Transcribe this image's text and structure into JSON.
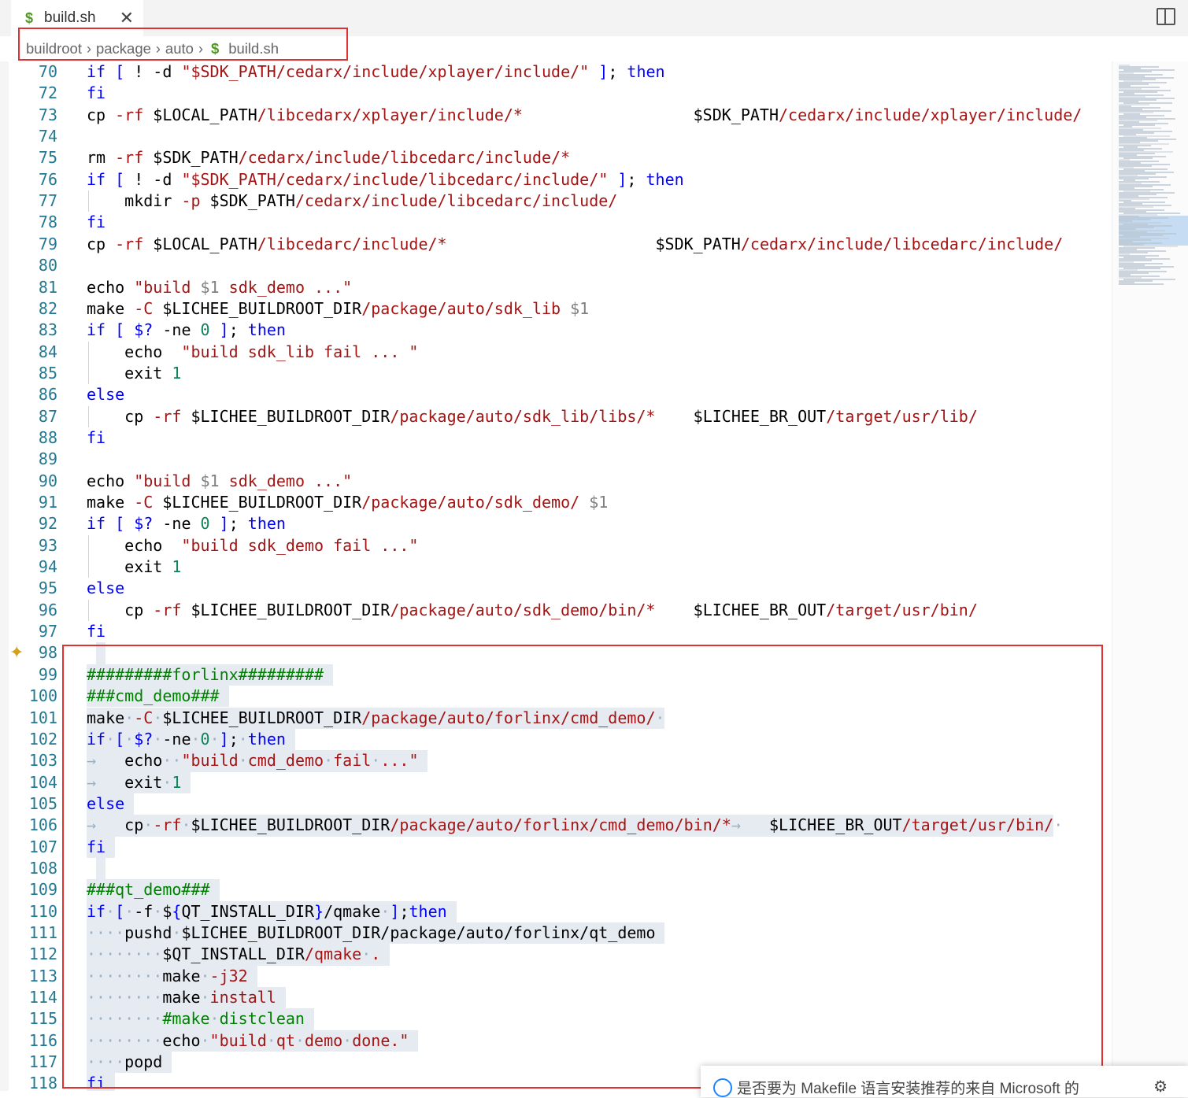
{
  "tab": {
    "icon": "$",
    "label": "build.sh",
    "close": "✕"
  },
  "breadcrumb": [
    {
      "label": "buildroot"
    },
    {
      "label": "package"
    },
    {
      "label": "auto"
    },
    {
      "label": "build.sh",
      "icon": "$"
    }
  ],
  "editor": {
    "lines": [
      {
        "n": "70",
        "indent": 0,
        "html": "<span class='kw'>if</span> <span class='kw'>[</span> ! -d <span class='str'>\"$SDK_PATH</span><span class='path'>/cedarx/include/xplayer/include/\"</span> <span class='kw'>]</span>; <span class='kw'>then</span>"
      },
      {
        "n": "72",
        "indent": 0,
        "html": "<span class='kw'>fi</span>"
      },
      {
        "n": "73",
        "indent": 0,
        "html": "cp <span class='str'>-rf</span> $LOCAL_PATH<span class='path'>/libcedarx/xplayer/include/*</span>                  $SDK_PATH<span class='path'>/cedarx/include/xplayer/include/</span>"
      },
      {
        "n": "74",
        "indent": 0,
        "html": ""
      },
      {
        "n": "75",
        "indent": 0,
        "html": "rm <span class='str'>-rf</span> $SDK_PATH<span class='path'>/cedarx/include/libcedarc/include/*</span>"
      },
      {
        "n": "76",
        "indent": 0,
        "html": "<span class='kw'>if</span> <span class='kw'>[</span> ! -d <span class='str'>\"$SDK_PATH</span><span class='path'>/cedarx/include/libcedarc/include/\"</span> <span class='kw'>]</span>; <span class='kw'>then</span>"
      },
      {
        "n": "77",
        "indent": 1,
        "html": "    mkdir <span class='str'>-p</span> $SDK_PATH<span class='path'>/cedarx/include/libcedarc/include/</span>"
      },
      {
        "n": "78",
        "indent": 0,
        "html": "<span class='kw'>fi</span>"
      },
      {
        "n": "79",
        "indent": 0,
        "html": "cp <span class='str'>-rf</span> $LOCAL_PATH<span class='path'>/libcedarc/include/*</span>                      $SDK_PATH<span class='path'>/cedarx/include/libcedarc/include/</span>"
      },
      {
        "n": "80",
        "indent": 0,
        "html": ""
      },
      {
        "n": "81",
        "indent": 0,
        "html": "echo <span class='str'>\"build </span><span class='arg'>$1</span><span class='str'> sdk_demo ...\"</span>"
      },
      {
        "n": "82",
        "indent": 0,
        "html": "make <span class='str'>-C</span> $LICHEE_BUILDROOT_DIR<span class='path'>/package/auto/sdk_lib</span> <span class='arg'>$1</span>"
      },
      {
        "n": "83",
        "indent": 0,
        "html": "<span class='kw'>if</span> <span class='kw'>[</span> <span class='kw'>$?</span> -ne <span class='num'>0</span> <span class='kw'>]</span>; <span class='kw'>then</span>"
      },
      {
        "n": "84",
        "indent": 1,
        "html": "    echo  <span class='str'>\"build sdk_lib fail ... \"</span>"
      },
      {
        "n": "85",
        "indent": 1,
        "html": "    exit <span class='num'>1</span>"
      },
      {
        "n": "86",
        "indent": 0,
        "html": "<span class='kw'>else</span>"
      },
      {
        "n": "87",
        "indent": 1,
        "html": "    cp <span class='str'>-rf</span> $LICHEE_BUILDROOT_DIR<span class='path'>/package/auto/sdk_lib/libs/*</span>    $LICHEE_BR_OUT<span class='path'>/target/usr/lib/</span>"
      },
      {
        "n": "88",
        "indent": 0,
        "html": "<span class='kw'>fi</span>"
      },
      {
        "n": "89",
        "indent": 0,
        "html": ""
      },
      {
        "n": "90",
        "indent": 0,
        "html": "echo <span class='str'>\"build </span><span class='arg'>$1</span><span class='str'> sdk_demo ...\"</span>"
      },
      {
        "n": "91",
        "indent": 0,
        "html": "make <span class='str'>-C</span> $LICHEE_BUILDROOT_DIR<span class='path'>/package/auto/sdk_demo/</span> <span class='arg'>$1</span>"
      },
      {
        "n": "92",
        "indent": 0,
        "html": "<span class='kw'>if</span> <span class='kw'>[</span> <span class='kw'>$?</span> -ne <span class='num'>0</span> <span class='kw'>]</span>; <span class='kw'>then</span>"
      },
      {
        "n": "93",
        "indent": 1,
        "html": "    echo  <span class='str'>\"build sdk_demo fail ...\"</span>"
      },
      {
        "n": "94",
        "indent": 1,
        "html": "    exit <span class='num'>1</span>"
      },
      {
        "n": "95",
        "indent": 0,
        "html": "<span class='kw'>else</span>"
      },
      {
        "n": "96",
        "indent": 1,
        "html": "    cp <span class='str'>-rf</span> $LICHEE_BUILDROOT_DIR<span class='path'>/package/auto/sdk_demo/bin/*</span>    $LICHEE_BR_OUT<span class='path'>/target/usr/bin/</span>"
      },
      {
        "n": "97",
        "indent": 0,
        "html": "<span class='kw'>fi</span>"
      },
      {
        "n": "98",
        "indent": 0,
        "html": "",
        "sel": 1
      },
      {
        "n": "99",
        "indent": 0,
        "html": "<span class='cmt'>#########forlinx#########</span>",
        "sel": 26
      },
      {
        "n": "100",
        "indent": 0,
        "html": "<span class='cmt'>###cmd_demo###</span>",
        "sel": 15
      },
      {
        "n": "101",
        "indent": 0,
        "html": "make<span class='ws'>·</span><span class='str'>-C</span><span class='ws'>·</span>$LICHEE_BUILDROOT_DIR<span class='path'>/package/auto/forlinx/cmd_demo/</span><span class='ws'>·</span>",
        "sel": 61
      },
      {
        "n": "102",
        "indent": 0,
        "html": "<span class='kw'>if</span><span class='ws'>·</span><span class='kw'>[</span><span class='ws'>·</span><span class='kw'>$?</span><span class='ws'>·</span>-ne<span class='ws'>·</span><span class='num'>0</span><span class='ws'>·</span><span class='kw'>]</span>;<span class='ws'>·</span><span class='kw'>then</span>",
        "sel": 22
      },
      {
        "n": "103",
        "indent": 0,
        "html": "<span class='ws'>→</span>   echo<span class='ws'>·</span><span class='ws'>·</span><span class='str'>\"build</span><span class='ws'>·</span><span class='str'>cmd_demo</span><span class='ws'>·</span><span class='str'>fail</span><span class='ws'>·</span><span class='str'>...\"</span>",
        "sel": 36
      },
      {
        "n": "104",
        "indent": 0,
        "html": "<span class='ws'>→</span>   exit<span class='ws'>·</span><span class='num'>1</span>",
        "sel": 11
      },
      {
        "n": "105",
        "indent": 0,
        "html": "<span class='kw'>else</span>",
        "sel": 5
      },
      {
        "n": "106",
        "indent": 0,
        "html": "<span class='ws'>→</span>   cp<span class='ws'>·</span><span class='str'>-rf</span><span class='ws'>·</span>$LICHEE_BUILDROOT_DIR<span class='path'>/package/auto/forlinx/cmd_demo/bin/*</span><span class='ws'>→</span>   $LICHEE_BR_OUT<span class='path'>/target/usr/bin/</span><span class='ws'>·</span>",
        "sel": 102
      },
      {
        "n": "107",
        "indent": 0,
        "html": "<span class='kw'>fi</span>",
        "sel": 3
      },
      {
        "n": "108",
        "indent": 0,
        "html": "",
        "sel": 1
      },
      {
        "n": "109",
        "indent": 0,
        "html": "<span class='cmt'>###qt_demo###</span>",
        "sel": 14
      },
      {
        "n": "110",
        "indent": 0,
        "html": "<span class='kw'>if</span><span class='ws'>·</span><span class='kw'>[</span><span class='ws'>·</span>-f<span class='ws'>·</span>$<span class='kw'>{</span>QT_INSTALL_DIR<span class='kw'>}</span>/qmake<span class='ws'>·</span><span class='kw'>]</span>;<span class='kw'>then</span>",
        "sel": 39
      },
      {
        "n": "111",
        "indent": 0,
        "html": "<span class='ws'>····</span>pushd<span class='ws'>·</span>$LICHEE_BUILDROOT_DIR/package/auto/forlinx/qt_demo",
        "sel": 61
      },
      {
        "n": "112",
        "indent": 0,
        "html": "<span class='ws'>········</span>$QT_INSTALL_DIR<span class='path'>/qmake</span><span class='ws'>·</span><span class='str'>.</span>",
        "sel": 32
      },
      {
        "n": "113",
        "indent": 0,
        "html": "<span class='ws'>········</span>make<span class='ws'>·</span><span class='str'>-j32</span>",
        "sel": 18
      },
      {
        "n": "114",
        "indent": 0,
        "html": "<span class='ws'>········</span>make<span class='ws'>·</span><span class='str'>install</span>",
        "sel": 21
      },
      {
        "n": "115",
        "indent": 0,
        "html": "<span class='ws'>········</span><span class='cmt'>#make</span><span class='ws'>·</span><span class='cmt'>distclean</span>",
        "sel": 24
      },
      {
        "n": "116",
        "indent": 0,
        "html": "<span class='ws'>········</span>echo<span class='ws'>·</span><span class='str'>\"build</span><span class='ws'>·</span><span class='str'>qt</span><span class='ws'>·</span><span class='str'>demo</span><span class='ws'>·</span><span class='str'>done.\"</span>",
        "sel": 35
      },
      {
        "n": "117",
        "indent": 0,
        "html": "<span class='ws'>····</span>popd",
        "sel": 9
      },
      {
        "n": "118",
        "indent": 0,
        "html": "<span class='kw'>fi</span>",
        "sel": 3
      }
    ]
  },
  "notification": {
    "message": "是否要为 Makefile 语言安装推荐的来自 Microsoft 的"
  },
  "colors": {
    "highlight_box": "#e03030",
    "line_number": "#237893",
    "selection": "#e5ebf1"
  }
}
